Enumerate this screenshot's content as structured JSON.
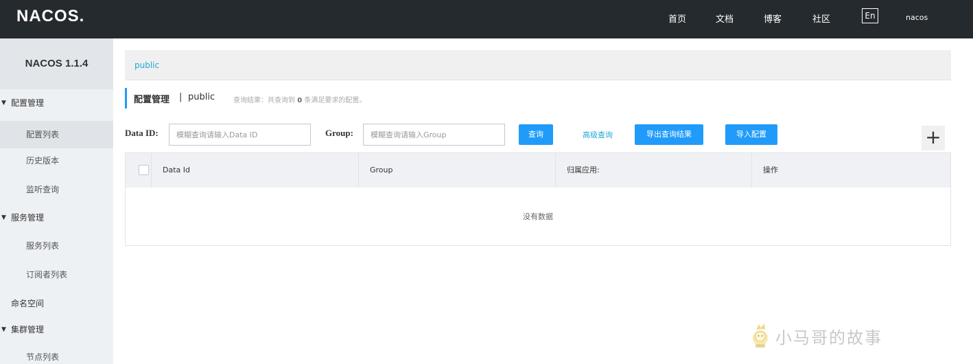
{
  "header": {
    "logo": "NACOS.",
    "nav": [
      "首页",
      "文档",
      "博客",
      "社区"
    ],
    "lang": "En",
    "user": "nacos"
  },
  "sidebar": {
    "version": "NACOS 1.1.4",
    "items": [
      {
        "label": "配置管理",
        "type": "group"
      },
      {
        "label": "配置列表",
        "type": "sub",
        "active": true
      },
      {
        "label": "历史版本",
        "type": "sub"
      },
      {
        "label": "监听查询",
        "type": "sub"
      },
      {
        "label": "服务管理",
        "type": "group"
      },
      {
        "label": "服务列表",
        "type": "sub"
      },
      {
        "label": "订阅者列表",
        "type": "sub"
      },
      {
        "label": "命名空间",
        "type": "plain"
      },
      {
        "label": "集群管理",
        "type": "group"
      },
      {
        "label": "节点列表",
        "type": "sub"
      }
    ]
  },
  "breadcrumb": "public",
  "title": {
    "main": "配置管理",
    "sep": "|",
    "namespace": "public",
    "result_prefix": "查询结果：共查询到",
    "result_count": "0",
    "result_suffix": "条满足要求的配置。"
  },
  "search": {
    "data_id_label": "Data ID:",
    "data_id_placeholder": "模糊查询请输入Data ID",
    "group_label": "Group:",
    "group_placeholder": "模糊查询请输入Group",
    "query_button": "查询",
    "advanced_link": "高级查询",
    "export_button": "导出查询结果",
    "import_button": "导入配置",
    "add_button": "+"
  },
  "table": {
    "columns": [
      "Data Id",
      "Group",
      "归属应用:",
      "操作"
    ],
    "empty": "没有数据"
  },
  "watermark": "小马哥的故事",
  "colors": {
    "topbar": "#252a2f",
    "primary": "#209bfa",
    "link": "#1fa8d8"
  }
}
